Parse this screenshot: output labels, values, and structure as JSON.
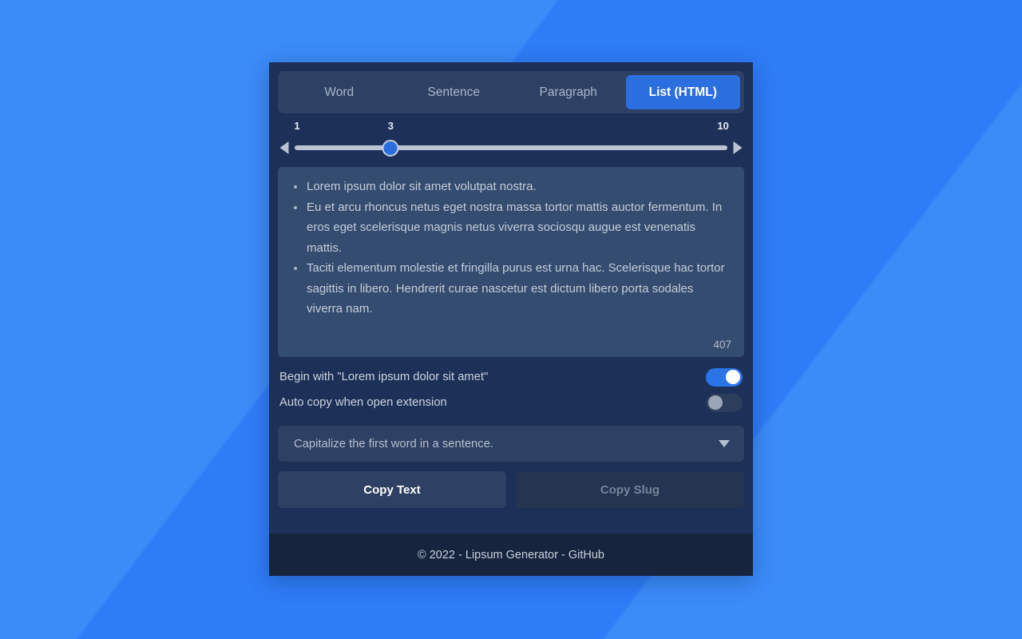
{
  "tabs": [
    {
      "label": "Word",
      "active": false
    },
    {
      "label": "Sentence",
      "active": false
    },
    {
      "label": "Paragraph",
      "active": false
    },
    {
      "label": "List (HTML)",
      "active": true
    }
  ],
  "slider": {
    "min_label": "1",
    "current_label": "3",
    "max_label": "10",
    "min": 1,
    "max": 10,
    "value": 3,
    "left_arrow_icon": "triangle-left-icon",
    "right_arrow_icon": "triangle-right-icon"
  },
  "output": {
    "items": [
      "Lorem ipsum dolor sit amet volutpat nostra.",
      "Eu et arcu rhoncus netus eget nostra massa tortor mattis auctor fermentum. In eros eget scelerisque magnis netus viverra sociosqu augue est venenatis mattis.",
      "Taciti elementum molestie et fringilla purus est urna hac. Scelerisque hac tortor sagittis in libero. Hendrerit curae nascetur est dictum libero porta sodales viverra nam."
    ],
    "char_count": "407"
  },
  "options": [
    {
      "label": "Begin with \"Lorem ipsum dolor sit amet\"",
      "state": "on"
    },
    {
      "label": "Auto copy when open extension",
      "state": "off"
    }
  ],
  "select": {
    "value": "Capitalize the first word in a sentence.",
    "caret_icon": "chevron-down-icon"
  },
  "actions": {
    "primary_label": "Copy Text",
    "secondary_label": "Copy Slug"
  },
  "footer": {
    "text": "© 2022 - Lipsum Generator - GitHub"
  },
  "colors": {
    "page_background": "#3586f7",
    "panel": "#1c3058",
    "panel_alt": "#2e4063",
    "textarea": "#344c70",
    "accent": "#2a6ee0",
    "toggle_on": "#2a74e8",
    "footer": "#16243d"
  }
}
